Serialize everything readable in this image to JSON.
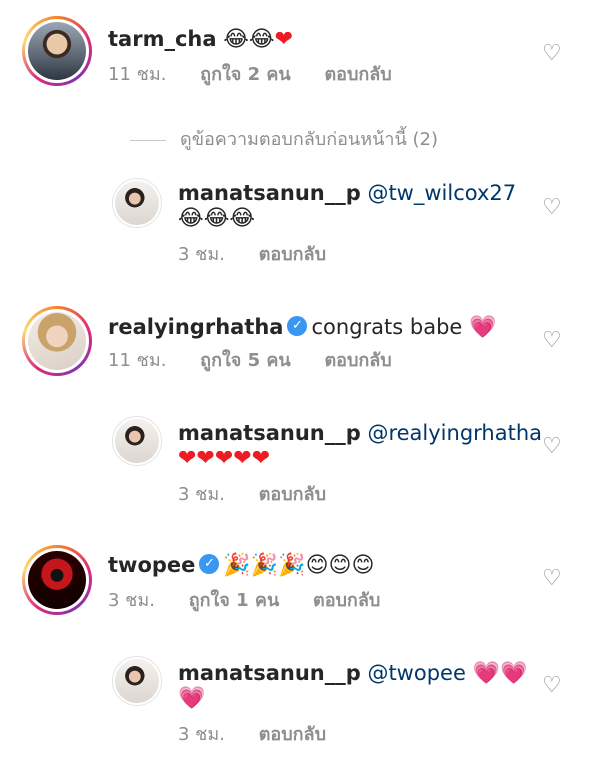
{
  "comments": [
    {
      "username": "tarm_cha",
      "text": "😂😂",
      "heart": "❤",
      "time": "11 ชม.",
      "likes": "ถูกใจ 2 คน",
      "reply": "ตอบกลับ"
    },
    {
      "username": "realyingrhatha",
      "text": "congrats babe",
      "heart": "💗",
      "time": "11 ชม.",
      "likes": "ถูกใจ 5 คน",
      "reply": "ตอบกลับ"
    },
    {
      "username": "twopee",
      "text": "🎉🎉🎉😊😊😊",
      "time": "3 ชม.",
      "likes": "ถูกใจ 1 คน",
      "reply": "ตอบกลับ"
    }
  ],
  "view_previous": "ดูข้อความตอบกลับก่อนหน้านี้ (2)",
  "replies": [
    {
      "username": "manatsanun__p",
      "mention": "@tw_wilcox27",
      "text": "😂😂😂",
      "time": "3 ชม.",
      "reply": "ตอบกลับ"
    },
    {
      "username": "manatsanun__p",
      "mention": "@realyingrhatha",
      "text": "❤❤❤❤❤",
      "time": "3 ชม.",
      "reply": "ตอบกลับ"
    },
    {
      "username": "manatsanun__p",
      "mention": "@twopee",
      "text_inline": "💗💗",
      "text": "💗",
      "time": "3 ชม.",
      "reply": "ตอบกลับ"
    }
  ],
  "icons": {
    "like": "heart-outline-icon",
    "verified": "verified-badge-icon",
    "verified_glyph": "✓",
    "like_glyph": "♡"
  },
  "colors": {
    "mention": "#00376b",
    "verified": "#3897f0",
    "meta": "#8e8e8e"
  }
}
